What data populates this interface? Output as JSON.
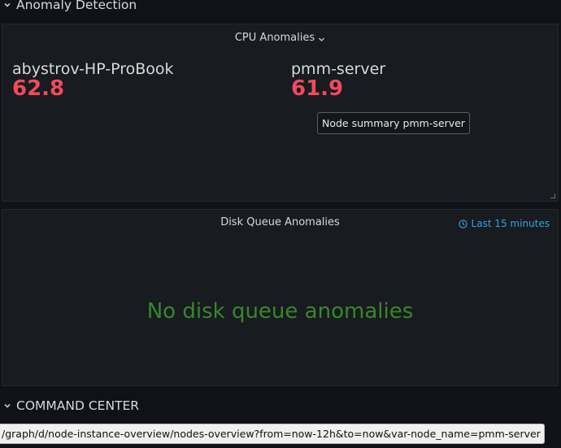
{
  "rows": {
    "anomaly_detection": "Anomaly Detection",
    "command_center": "COMMAND CENTER"
  },
  "cpu_panel": {
    "title": "CPU Anomalies",
    "stats": [
      {
        "name": "abystrov-HP-ProBook",
        "value": "62.8"
      },
      {
        "name": "pmm-server",
        "value": "61.9"
      }
    ],
    "tooltip": "Node summary pmm-server",
    "value_color": "#f2495c"
  },
  "disk_panel": {
    "title": "Disk Queue Anomalies",
    "time_range": "Last 15 minutes",
    "empty_message": "No disk queue anomalies",
    "message_color": "#37872d"
  },
  "status_bar": {
    "url": "/graph/d/node-instance-overview/nodes-overview?from=now-12h&to=now&var-node_name=pmm-server"
  },
  "icons": {
    "row_toggle": "chevron-down-icon",
    "title_menu": "caret-down-icon",
    "time": "clock-icon"
  }
}
